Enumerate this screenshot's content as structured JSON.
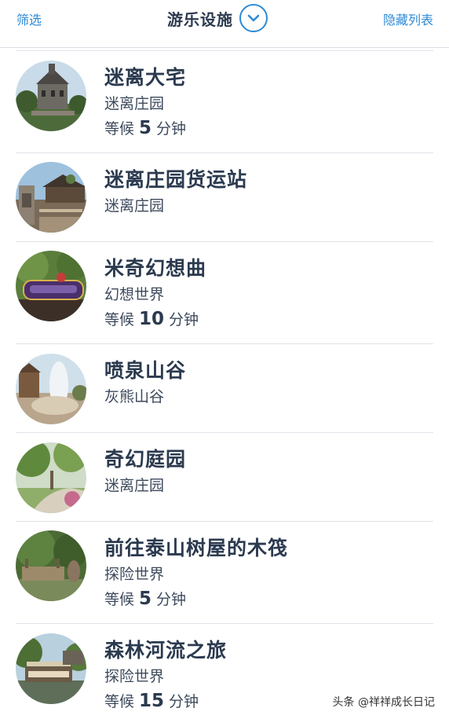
{
  "header": {
    "filter_label": "筛选",
    "title": "游乐设施",
    "hide_list_label": "隐藏列表",
    "accent": "#2e8ad6"
  },
  "attractions": [
    {
      "name": "迷离大宅",
      "area": "迷离庄园",
      "wait_prefix": "等候",
      "wait_minutes": "5",
      "wait_unit": "分钟"
    },
    {
      "name": "迷离庄园货运站",
      "area": "迷离庄园"
    },
    {
      "name": "米奇幻想曲",
      "area": "幻想世界",
      "wait_prefix": "等候",
      "wait_minutes": "10",
      "wait_unit": "分钟"
    },
    {
      "name": "喷泉山谷",
      "area": "灰熊山谷"
    },
    {
      "name": "奇幻庭园",
      "area": "迷离庄园"
    },
    {
      "name": "前往泰山树屋的木筏",
      "area": "探险世界",
      "wait_prefix": "等候",
      "wait_minutes": "5",
      "wait_unit": "分钟"
    },
    {
      "name": "森林河流之旅",
      "area": "探险世界",
      "wait_prefix": "等候",
      "wait_minutes": "15",
      "wait_unit": "分钟"
    }
  ],
  "watermark": "头条 @祥祥成长日记"
}
